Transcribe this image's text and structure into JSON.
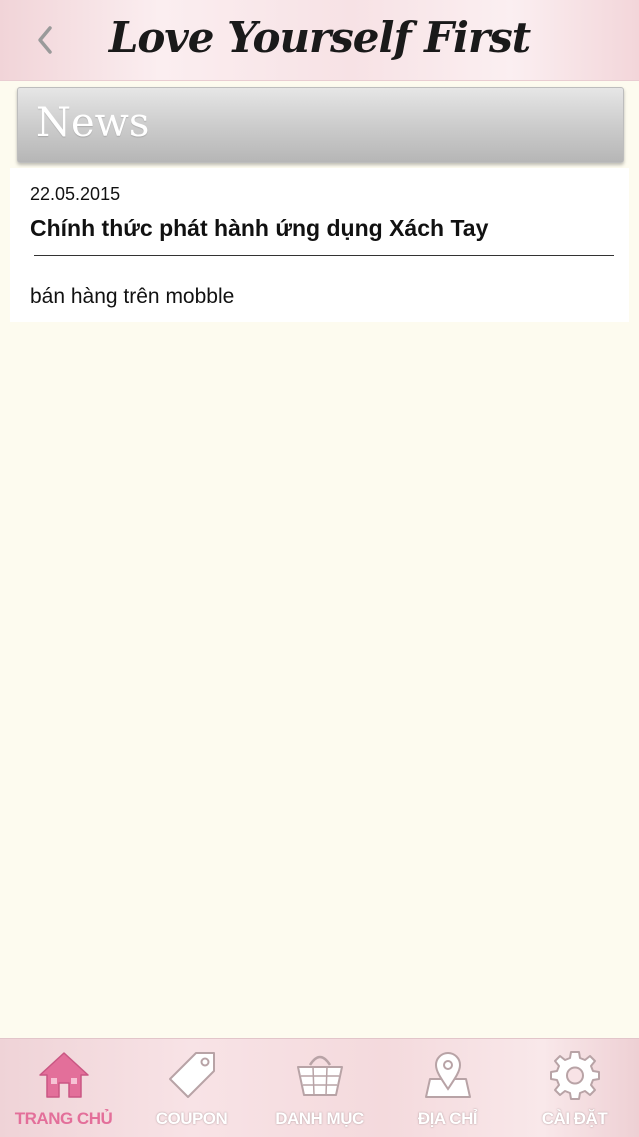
{
  "header": {
    "title": "Love Yourself First",
    "back_icon": "chevron-left-icon"
  },
  "section": {
    "title": "News"
  },
  "news": [
    {
      "date": "22.05.2015",
      "title": "Chính thức phát hành ứng dụng Xách Tay",
      "excerpt": "bán hàng trên mobble"
    }
  ],
  "tabbar": {
    "items": [
      {
        "label": "TRANG CHỦ",
        "icon": "home-icon",
        "active": true
      },
      {
        "label": "COUPON",
        "icon": "tag-icon",
        "active": false
      },
      {
        "label": "DANH MỤC",
        "icon": "basket-icon",
        "active": false
      },
      {
        "label": "ĐỊA CHỈ",
        "icon": "map-pin-icon",
        "active": false
      },
      {
        "label": "CÀI ĐẶT",
        "icon": "gear-icon",
        "active": false
      }
    ]
  },
  "colors": {
    "accent": "#e36f9a",
    "background": "#fdfbef",
    "header_bg": "#f7e2e5",
    "inactive_tab": "#ffffff"
  }
}
